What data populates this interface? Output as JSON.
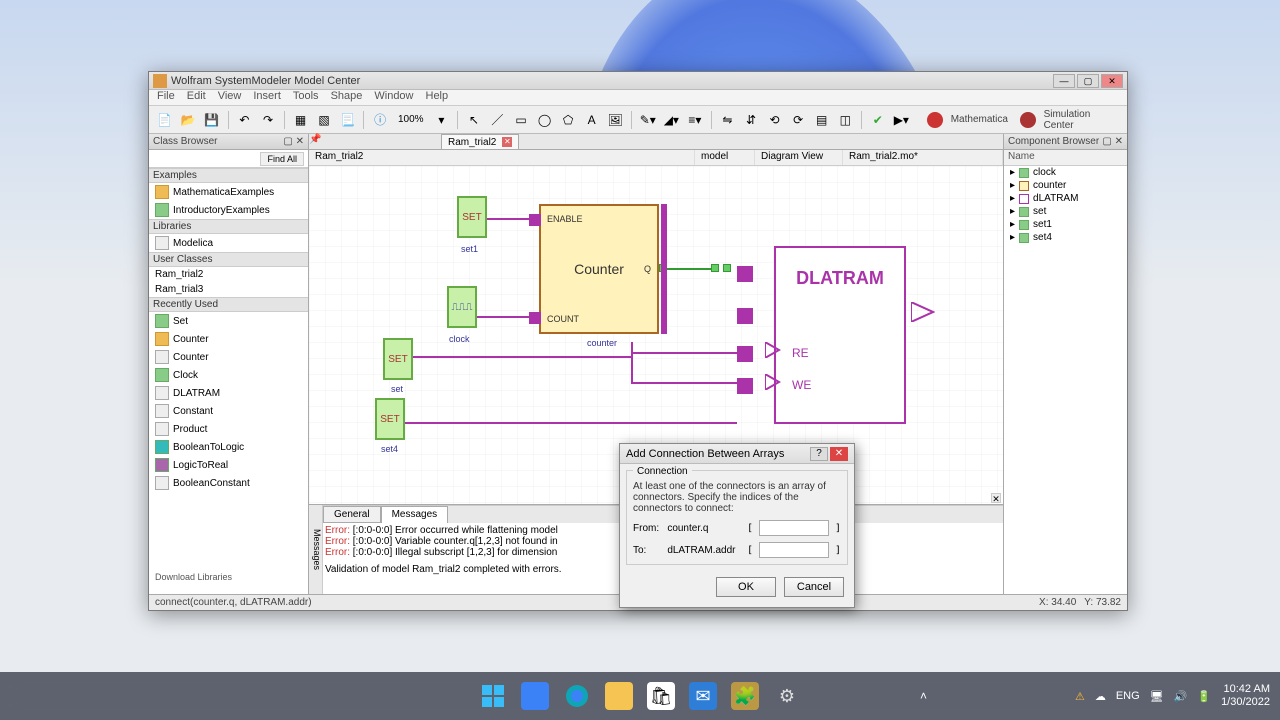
{
  "window": {
    "title": "Wolfram SystemModeler Model Center"
  },
  "menu": [
    "File",
    "Edit",
    "View",
    "Insert",
    "Tools",
    "Shape",
    "Window",
    "Help"
  ],
  "toolbar": {
    "zoom": "100%",
    "right": {
      "mathematica": "Mathematica",
      "simcenter": "Simulation Center"
    }
  },
  "class_browser": {
    "title": "Class Browser",
    "find_all": "Find All",
    "sections": {
      "examples": "Examples",
      "libraries": "Libraries",
      "user_classes": "User Classes",
      "recently_used": "Recently Used"
    },
    "examples_items": [
      "MathematicaExamples",
      "IntroductoryExamples"
    ],
    "libraries_items": [
      "Modelica"
    ],
    "user_classes_items": [
      "Ram_trial2",
      "Ram_trial3"
    ],
    "recently_used_items": [
      "Set",
      "Counter",
      "Counter",
      "Clock",
      "DLATRAM",
      "Constant",
      "Product",
      "BooleanToLogic",
      "LogicToReal",
      "BooleanConstant"
    ],
    "download": "Download Libraries"
  },
  "tabs": {
    "active": "Ram_trial2"
  },
  "info": {
    "path": "Ram_trial2",
    "kind": "model",
    "view": "Diagram View",
    "file": "Ram_trial2.mo*"
  },
  "canvas": {
    "set1_lbl": "set1",
    "set_lbl": "set",
    "set4_lbl": "set4",
    "clock_lbl": "clock",
    "counter_lbl": "counter",
    "SET": "SET",
    "counter_title": "Counter",
    "ENABLE": "ENABLE",
    "COUNT": "COUNT",
    "Q": "Q",
    "dlatram": "DLATRAM",
    "RE": "RE",
    "WE": "WE",
    "clock_sig": "⎍⎍⎍"
  },
  "messages": {
    "tabs": {
      "general": "General",
      "messages": "Messages"
    },
    "side": "Messages",
    "lines": [
      {
        "err": "Error:",
        "txt": " [:0:0-0:0] Error occurred while flattening model"
      },
      {
        "err": "Error:",
        "txt": " [:0:0-0:0] Variable counter.q[1,2,3] not found in"
      },
      {
        "err": "Error:",
        "txt": " [:0:0-0:0] Illegal subscript [1,2,3] for dimension"
      },
      {
        "err": "",
        "txt": "Validation of model Ram_trial2 completed with errors."
      }
    ]
  },
  "component_browser": {
    "title": "Component Browser",
    "name_hdr": "Name",
    "items": [
      "clock",
      "counter",
      "dLATRAM",
      "set",
      "set1",
      "set4"
    ]
  },
  "statusbar": {
    "hint": "connect(counter.q, dLATRAM.addr)",
    "x": "X: 34.40",
    "y": "Y: 73.82"
  },
  "dialog": {
    "title": "Add Connection Between Arrays",
    "group": "Connection",
    "help": "At least one of the connectors is an array of connectors. Specify the indices of the connectors to connect:",
    "from_lbl": "From:",
    "from_val": "counter.q",
    "to_lbl": "To:",
    "to_val": "dLATRAM.addr",
    "ok": "OK",
    "cancel": "Cancel"
  },
  "taskbar": {
    "lang": "ENG",
    "time": "10:42 AM",
    "date": "1/30/2022"
  }
}
